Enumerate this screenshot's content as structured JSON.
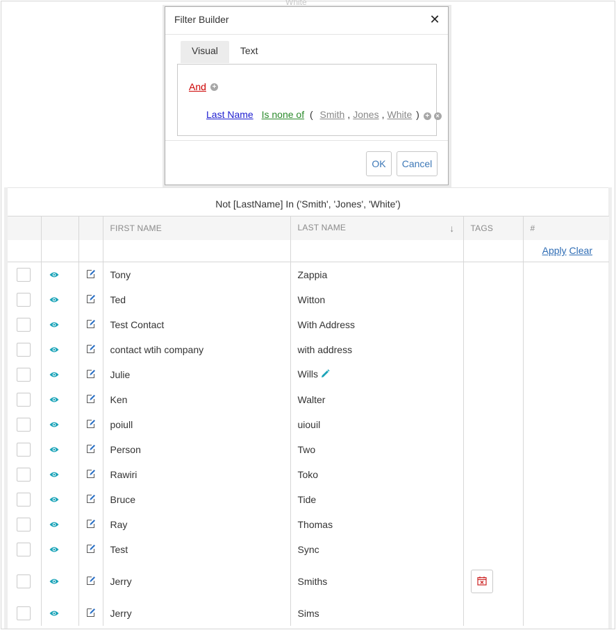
{
  "background_text": "White",
  "dialog": {
    "title": "Filter Builder",
    "tabs": [
      {
        "label": "Visual",
        "active": true
      },
      {
        "label": "Text",
        "active": false
      }
    ],
    "group_operator": "And",
    "condition": {
      "field": "Last Name",
      "operator": "Is none of",
      "open": "(",
      "values": [
        "Smith",
        "Jones",
        "White"
      ],
      "separator": ",",
      "close": ")"
    },
    "ok_label": "OK",
    "cancel_label": "Cancel"
  },
  "grid": {
    "filter_text": "Not [LastName] In ('Smith', 'Jones', 'White')",
    "columns": {
      "first_name": "FIRST NAME",
      "last_name": "LAST NAME",
      "tags": "TAGS",
      "number": "#"
    },
    "sort_indicator": "↓",
    "apply_label": "Apply",
    "clear_label": "Clear",
    "rows": [
      {
        "first": "Tony",
        "last": "Zappia"
      },
      {
        "first": "Ted",
        "last": "Witton"
      },
      {
        "first": "Test Contact",
        "last": "With Address"
      },
      {
        "first": "contact wtih company",
        "last": "with address"
      },
      {
        "first": "Julie",
        "last": "Wills"
      },
      {
        "first": "Ken",
        "last": "Walter"
      },
      {
        "first": "poiull",
        "last": "uiouil"
      },
      {
        "first": "Person",
        "last": "Two"
      },
      {
        "first": "Rawiri",
        "last": "Toko"
      },
      {
        "first": "Bruce",
        "last": "Tide"
      },
      {
        "first": "Ray",
        "last": "Thomas"
      },
      {
        "first": "Test",
        "last": "Sync"
      },
      {
        "first": "Jerry",
        "last": "Smiths"
      },
      {
        "first": "Jerry",
        "last": "Sims"
      }
    ]
  },
  "colors": {
    "and": "#cc0000",
    "field": "#1d1dd0",
    "operator": "#2a8a2a",
    "link": "#2f6db5",
    "eye": "#1aa3b8",
    "edit": "#2a6fc4",
    "tag_icon": "#cc2222"
  }
}
